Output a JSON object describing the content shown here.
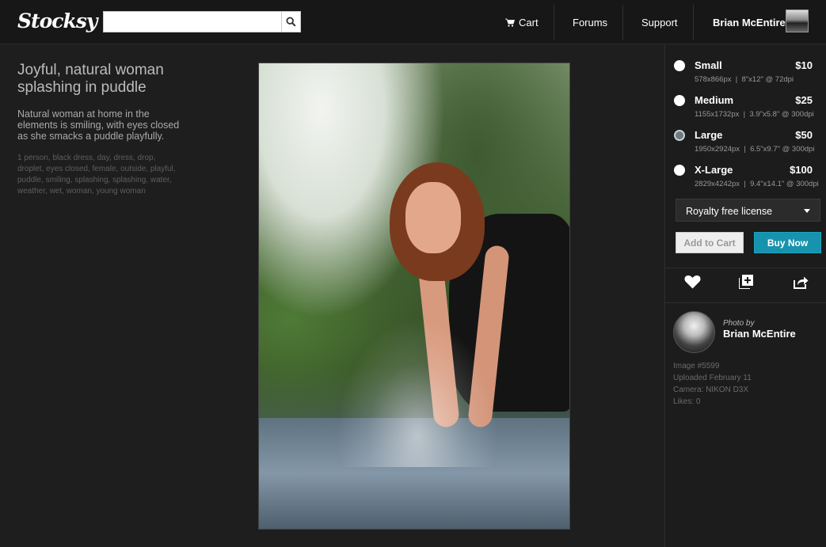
{
  "header": {
    "logo": "Stocksy",
    "search": {
      "value": "",
      "placeholder": ""
    },
    "nav": {
      "cart": "Cart",
      "forums": "Forums",
      "support": "Support",
      "user": "Brian McEntire"
    }
  },
  "image_info": {
    "title": "Joyful, natural woman splashing in puddle",
    "description": "Natural woman at home in the elements is smiling, with eyes closed as she smacks a puddle playfully.",
    "tags": "1 person, black dress, day, dress, drop, droplet, eyes closed, female, outside, playful, puddle, smiling, splashing, splashing, water, weather, wet, woman, young woman"
  },
  "sizes": [
    {
      "name": "Small",
      "price": "$10",
      "pixels": "578x866px",
      "print": "8\"x12\" @ 72dpi",
      "selected": false
    },
    {
      "name": "Medium",
      "price": "$25",
      "pixels": "1155x1732px",
      "print": "3.9\"x5.8\" @ 300dpi",
      "selected": false
    },
    {
      "name": "Large",
      "price": "$50",
      "pixels": "1950x2924px",
      "print": "6.5\"x9.7\" @ 300dpi",
      "selected": true
    },
    {
      "name": "X-Large",
      "price": "$100",
      "pixels": "2829x4242px",
      "print": "9.4\"x14.1\" @ 300dpi",
      "selected": false
    }
  ],
  "license": {
    "selected": "Royalty free license"
  },
  "buttons": {
    "add_to_cart": "Add to Cart",
    "buy_now": "Buy Now"
  },
  "actions": {
    "icons": [
      "heart-icon",
      "add-to-collection-icon",
      "share-icon"
    ]
  },
  "photographer": {
    "label": "Photo by",
    "name": "Brian McEntire",
    "image_number": "Image #5599",
    "uploaded": "Uploaded February 11",
    "camera": "Camera: NIKON D3X",
    "likes": "Likes: 0"
  },
  "colors": {
    "accent": "#1793ad",
    "background": "#1e1e1e",
    "topbar": "#171717"
  }
}
